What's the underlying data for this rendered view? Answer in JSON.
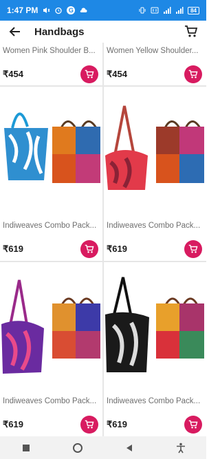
{
  "status_bar": {
    "time": "1:47 PM",
    "g_letter": "G",
    "battery": "84",
    "colors": {
      "background": "#1e88e5",
      "text": "#ffffff"
    },
    "icons": [
      "mute-icon",
      "alarm-icon",
      "cloud-icon",
      "vibrate-icon",
      "data-icon",
      "signal-icon",
      "wifi-icon",
      "battery-icon"
    ]
  },
  "app_bar": {
    "title": "Handbags",
    "back_icon": "arrow-left-icon",
    "cart_icon": "cart-icon"
  },
  "theme": {
    "accent": "#d81b60",
    "divider": "#e6e6e6"
  },
  "products": [
    {
      "name": "Women Pink Shoulder B...",
      "price": "₹454"
    },
    {
      "name": "Women Yellow Shoulder...",
      "price": "₹454"
    },
    {
      "name": "Indiweaves Combo Pack...",
      "price": "₹619"
    },
    {
      "name": "Indiweaves Combo Pack...",
      "price": "₹619"
    },
    {
      "name": "Indiweaves Combo Pack...",
      "price": "₹619"
    },
    {
      "name": "Indiweaves Combo Pack...",
      "price": "₹619"
    }
  ],
  "nav_bar": {
    "icons": [
      "recents-square-icon",
      "home-circle-icon",
      "back-triangle-icon",
      "accessibility-icon"
    ]
  }
}
